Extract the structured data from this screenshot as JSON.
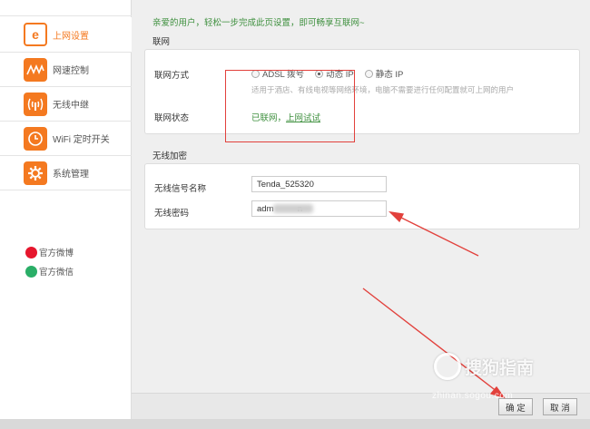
{
  "sidebar": {
    "items": [
      {
        "label": "上网设置",
        "icon": "ie-icon",
        "active": true
      },
      {
        "label": "网速控制",
        "icon": "speed-wave-icon"
      },
      {
        "label": "无线中继",
        "icon": "relay-icon"
      },
      {
        "label": "WiFi 定时开关",
        "icon": "timer-icon"
      },
      {
        "label": "系统管理",
        "icon": "gear-icon"
      }
    ],
    "social": [
      {
        "label": "官方微博",
        "icon": "weibo-icon"
      },
      {
        "label": "官方微信",
        "icon": "wechat-icon"
      }
    ]
  },
  "main": {
    "greeting": "亲爱的用户，轻松一步完成此页设置，即可畅享互联网~",
    "network_section": {
      "title": "联网",
      "mode_label": "联网方式",
      "options": [
        "ADSL 拨号",
        "动态 IP",
        "静态 IP"
      ],
      "selected": "动态 IP",
      "hint": "适用于酒店、有线电视等网络环境，电脑不需要进行任何配置就可上网的用户",
      "status_label": "联网状态",
      "status_text": "已联网，",
      "status_link": "上网试试"
    },
    "wireless_section": {
      "title": "无线加密",
      "ssid_label": "无线信号名称",
      "ssid_value": "Tenda_525320",
      "password_label": "无线密码",
      "password_value": "adm          n"
    },
    "buttons": {
      "ok": "确 定",
      "cancel": "取 消"
    }
  },
  "watermark": {
    "text": "搜狗指南",
    "url": "zhinan.sogou.com"
  },
  "colors": {
    "accent": "#f47920",
    "green": "#3d8f3d",
    "annotation": "#e2413c"
  }
}
